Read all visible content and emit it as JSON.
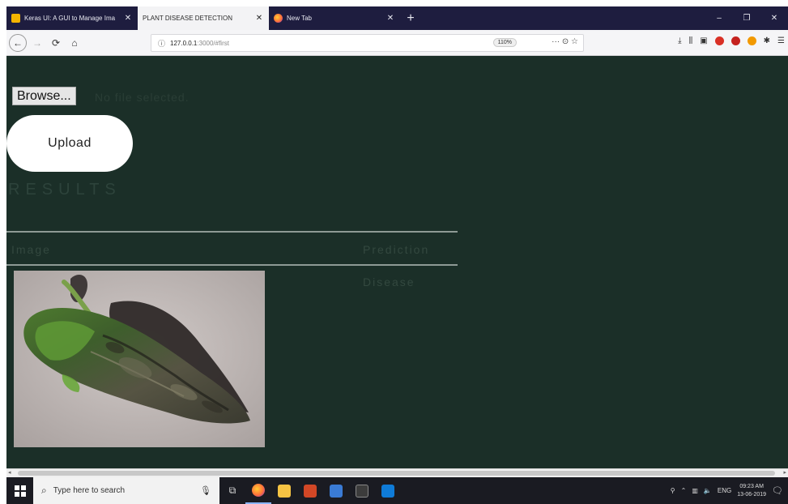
{
  "browser": {
    "tabs": [
      {
        "title": "Keras UI: A GUI to Manage Ima",
        "active": false,
        "favicon_color": "#f4b400",
        "close": "✕"
      },
      {
        "title": "PLANT DISEASE DETECTION",
        "active": true,
        "favicon_color": "",
        "close": "✕"
      },
      {
        "title": "New Tab",
        "active": false,
        "favicon_color": "#ff7139",
        "close": "✕"
      }
    ],
    "new_tab_label": "+",
    "window_controls": {
      "minimize": "–",
      "maximize": "❐",
      "close": "✕"
    },
    "url_host": "127.0.0.1",
    "url_path": ":3000/#first",
    "zoom": "110%",
    "page_actions": "··· ⊙ ☆"
  },
  "upload_form": {
    "browse_label": "Browse...",
    "file_status": "No file selected.",
    "upload_label": "Upload"
  },
  "results": {
    "heading": "RESULTS",
    "columns": [
      "Image",
      "Prediction"
    ],
    "rows": [
      {
        "image": "leaf-photo",
        "prediction": "Disease"
      }
    ]
  },
  "taskbar": {
    "search_placeholder": "Type here to search",
    "time": "09:23 AM",
    "date": "13-06-2019",
    "language": "ENG"
  },
  "colors": {
    "page_background": "#1b2f28",
    "tab_strip": "#1e1d3f",
    "taskbar": "#1a1b22"
  }
}
